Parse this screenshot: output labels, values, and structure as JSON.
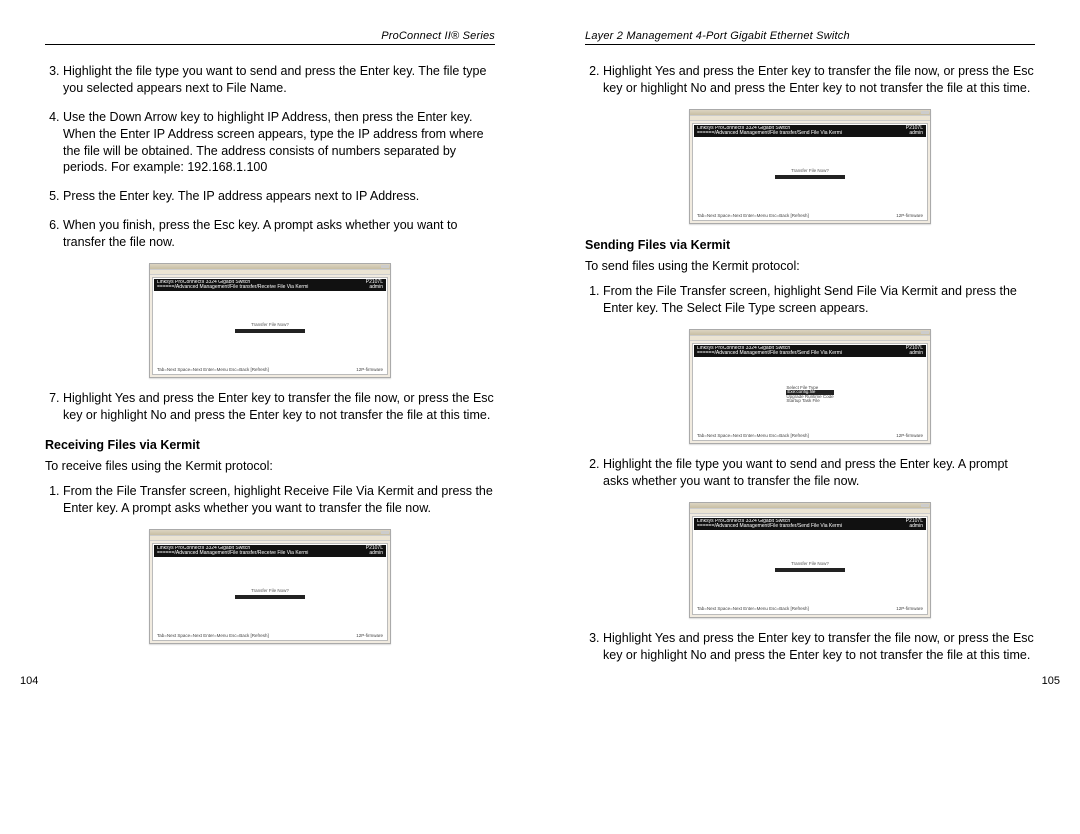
{
  "leftHeader": "ProConnect II® Series",
  "rightHeader": "Layer 2 Management 4-Port Gigabit Ethernet Switch",
  "left": {
    "steps_a": [
      "Highlight the file type you want to send and press the Enter key. The file type you selected appears next to File Name.",
      "Use the Down Arrow key to highlight IP Address, then press the Enter key. When the Enter IP Address screen appears, type the IP address from where the file will be obtained. The address consists of numbers separated by periods. For example: 192.168.1.100",
      "Press the Enter key. The IP address appears next to IP Address.",
      "When you finish, press the Esc key. A prompt asks whether you want to transfer the file now."
    ],
    "steps_b": [
      "Highlight Yes and press the Enter key to transfer the file now, or press the Esc key or highlight No and press the Enter key to not transfer the file at this time."
    ],
    "sectionHead": "Receiving Files via Kermit",
    "intro": "To receive files using the Kermit protocol:",
    "steps_c": [
      "From the File Transfer screen, highlight Receive File Via Kermit and press the Enter key. A prompt asks whether you want to transfer the file now."
    ],
    "pageNum": "104"
  },
  "right": {
    "steps_a": [
      "Highlight Yes and press the Enter key to transfer the file now, or press the Esc key or highlight No and press the Enter key to not transfer the file at this time."
    ],
    "sectionHead": "Sending Files via Kermit",
    "intro": "To send files using the Kermit protocol:",
    "steps_b": [
      "From the File Transfer screen, highlight Send File Via Kermit and press the Enter key. The Select File Type screen appears."
    ],
    "steps_c": [
      "Highlight the file type you want to send and press the Enter key. A prompt asks whether you want to transfer the file now."
    ],
    "steps_d": [
      "Highlight Yes and press the Enter key to transfer the file now, or press the Esc key or highlight No and press the Enter key to not transfer the file at this time."
    ],
    "pageNum": "105"
  },
  "screenshot": {
    "bannerLeft1": "Linksys ProConnectII 3324 Gigabit Switch",
    "bannerLeft2": "======/Advanced Management/File transfer/Receive File Via Kermi",
    "bannerLeft2b": "======/Advanced Management/File transfer/Send File Via Kermi",
    "bannerRight1": "P2107L",
    "bannerRight2": "admin",
    "prompt": "Transfer File Now?",
    "yes": "Yes",
    "fileTypeHead": "Select File Type",
    "fileTypes": [
      "Exe:config.file",
      "Upgrade Runtime Code",
      "Startup Task File"
    ],
    "status1": "Tab=Next Space=Next Enter=Menu  Esc=Back [Refresh]",
    "status2": "12P-firmware"
  }
}
